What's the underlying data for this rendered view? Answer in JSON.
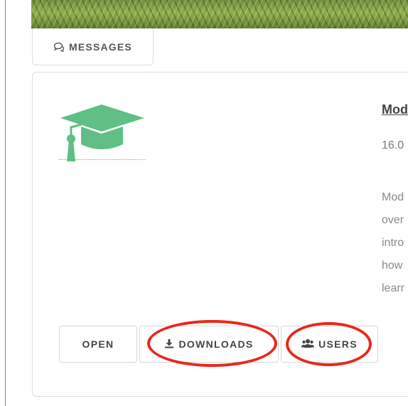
{
  "tabs": {
    "messages_label": "MESSAGES"
  },
  "course": {
    "title": "Mod",
    "version": "16.0",
    "description_lines": [
      "Mod",
      "over",
      "intro",
      "how",
      "learr"
    ]
  },
  "actions": {
    "open_label": "OPEN",
    "downloads_label": "DOWNLOADS",
    "users_label": "USERS"
  },
  "icons": {
    "messages": "comments-icon",
    "logo": "graduation-cap-icon",
    "downloads": "download-icon",
    "users": "users-icon"
  },
  "colors": {
    "logo_green": "#5fbf85",
    "annotation_red": "#e8281a",
    "text_dark": "#444444"
  }
}
